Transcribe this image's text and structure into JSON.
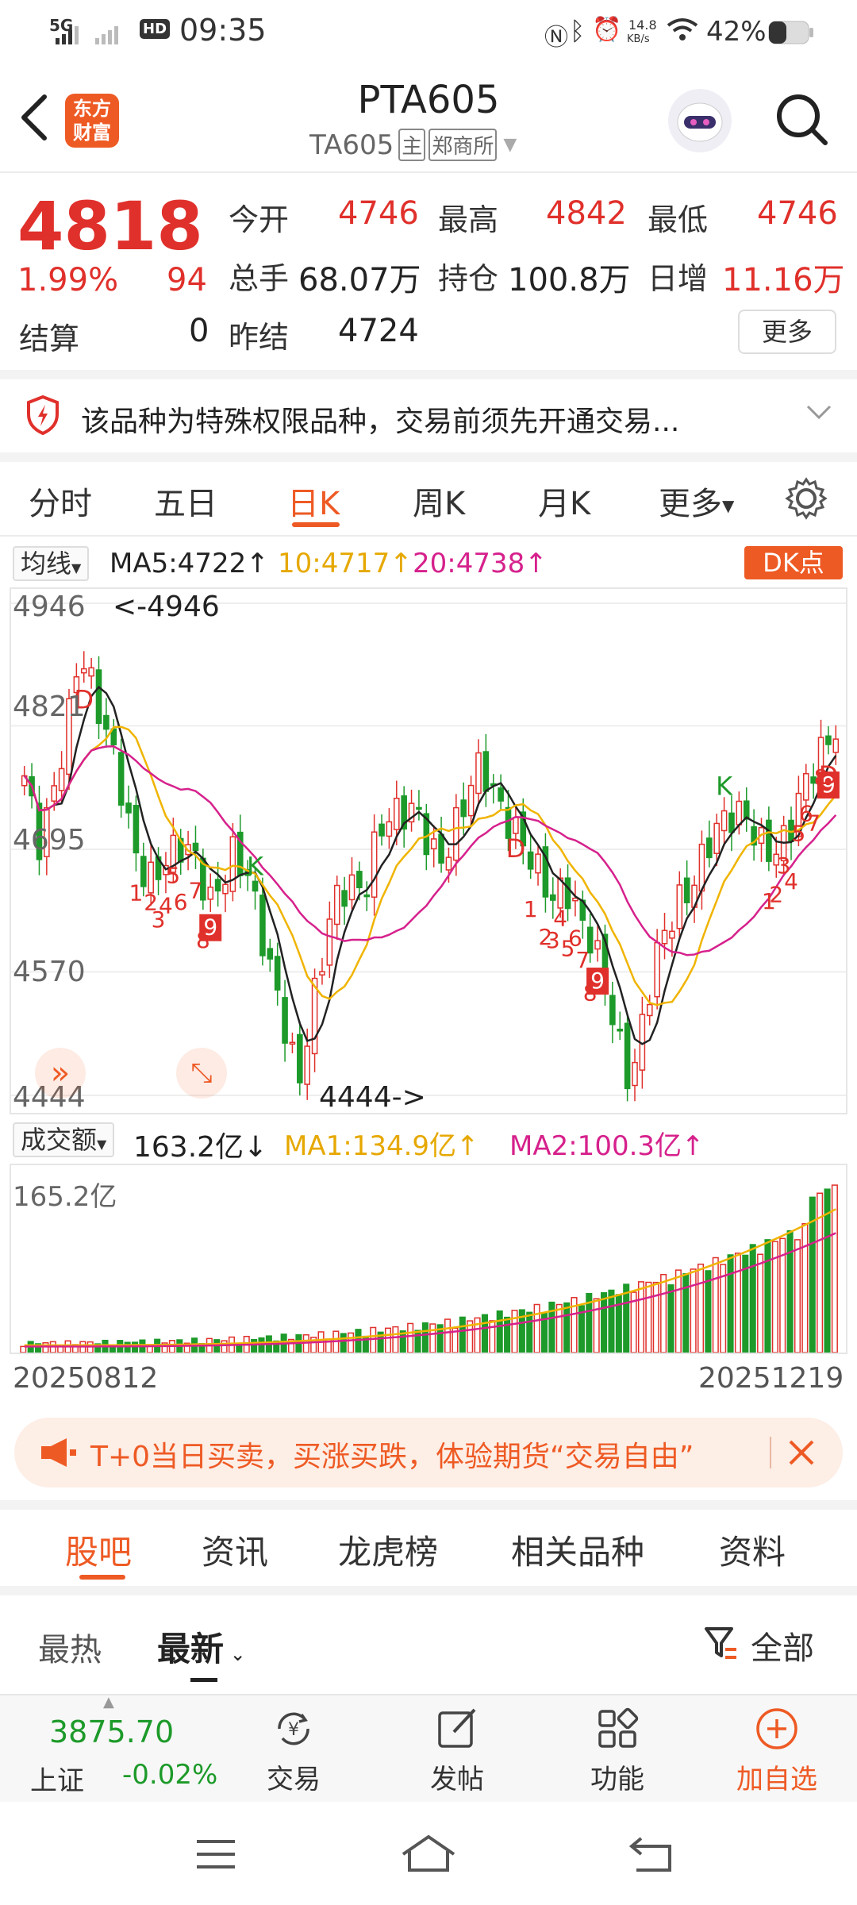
{
  "status_bar": {
    "network": "5G",
    "hd": "HD",
    "time": "09:35",
    "speed_top": "14.8",
    "speed_bottom": "KB/s",
    "battery": "42%"
  },
  "header": {
    "logo_line1": "东方",
    "logo_line2": "财富",
    "title": "PTA605",
    "code": "TA605",
    "badge_main": "主",
    "exchange": "郑商所"
  },
  "quote": {
    "price": "4818",
    "change_pct": "1.99%",
    "change": "94",
    "settle_label": "结算",
    "settle_value": "0",
    "open_label": "今开",
    "open_value": "4746",
    "high_label": "最高",
    "high_value": "4842",
    "low_label": "最低",
    "low_value": "4746",
    "volume_label": "总手",
    "volume_value": "68.07万",
    "oi_label": "持仓",
    "oi_value": "100.8万",
    "daily_inc_label": "日增",
    "daily_inc_value": "11.16万",
    "prev_settle_label": "昨结",
    "prev_settle_value": "4724",
    "more_button": "更多"
  },
  "notice": {
    "text": "该品种为特殊权限品种，交易前须先开通交易..."
  },
  "period_tabs": [
    "分时",
    "五日",
    "日K",
    "周K",
    "月K",
    "更多"
  ],
  "active_tab_index": 2,
  "chart_header": {
    "indicator_select": "均线",
    "ma5": "MA5:4722↑",
    "ma10": "10:4717↑",
    "ma20": "20:4738↑",
    "dk_button": "DK点"
  },
  "colors": {
    "up": "#e0302b",
    "down": "#1d9a2a",
    "ma5": "#222222",
    "ma10": "#f0b400",
    "ma20": "#d6218c",
    "accent": "#ee5a24"
  },
  "chart_data": [
    {
      "type": "candlestick",
      "title": "",
      "y_ticks": [
        "4946",
        "4821",
        "4695",
        "4570",
        "4444"
      ],
      "ylim": [
        4444,
        4946
      ],
      "high_annotation": "<-4946",
      "low_annotation": "4444->",
      "grid": true,
      "start_date": "20250812",
      "end_date": "20251219",
      "series": [
        {
          "name": "MA5",
          "last": 4722
        },
        {
          "name": "10",
          "last": 4717
        },
        {
          "name": "20",
          "last": 4738
        }
      ],
      "annotations": [
        "1",
        "2",
        "3",
        "4",
        "5",
        "6",
        "7",
        "8",
        "9",
        "K",
        "D"
      ]
    },
    {
      "type": "bar",
      "title": "成交额",
      "y_max_label": "165.2亿",
      "series": [
        {
          "name": "成交额",
          "last": "163.2亿↓"
        },
        {
          "name": "MA1",
          "last": "134.9亿↑"
        },
        {
          "name": "MA2",
          "last": "100.3亿↑"
        }
      ]
    }
  ],
  "volume_header": {
    "select": "成交额",
    "value": "163.2亿↓",
    "ma1": "MA1:134.9亿↑",
    "ma2": "MA2:100.3亿↑",
    "y_max": "165.2亿"
  },
  "dates": {
    "start": "20250812",
    "end": "20251219"
  },
  "promo": {
    "text": "T+0当日买卖，买涨买跌，体验期货“交易自由”"
  },
  "section_tabs": [
    "股吧",
    "资讯",
    "龙虎榜",
    "相关品种",
    "资料"
  ],
  "sort_tabs": {
    "hot": "最热",
    "latest": "最新",
    "filter": "全部"
  },
  "bottom_nav": {
    "index_value": "3875.70",
    "index_name": "上证",
    "index_change": "-0.02%",
    "trade": "交易",
    "post": "发帖",
    "functions": "功能",
    "add_watch": "加自选"
  }
}
